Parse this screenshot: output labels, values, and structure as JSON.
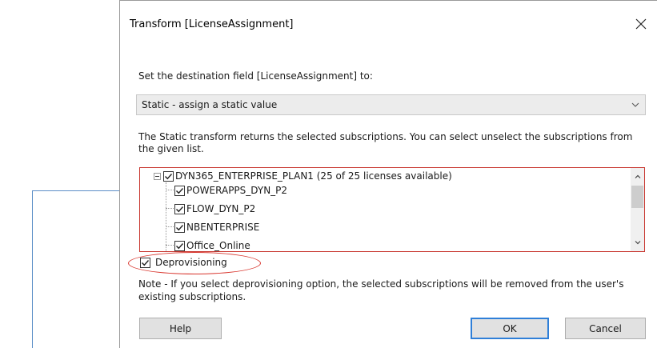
{
  "dialog": {
    "title": "Transform [LicenseAssignment]",
    "prompt": "Set the destination field [LicenseAssignment] to:",
    "dropdown_value": "Static - assign a static value",
    "description": "The Static transform returns the selected subscriptions. You can select unselect the subscriptions from the given list.",
    "tree": {
      "root": {
        "label": "DYN365_ENTERPRISE_PLAN1 (25 of 25 licenses available)",
        "checked": true,
        "expanded": true
      },
      "children": [
        {
          "label": "POWERAPPS_DYN_P2",
          "checked": true
        },
        {
          "label": "FLOW_DYN_P2",
          "checked": true
        },
        {
          "label": "NBENTERPRISE",
          "checked": true
        },
        {
          "label": "Office_Online",
          "checked": true
        }
      ]
    },
    "deprovisioning": {
      "label": "Deprovisioning",
      "checked": true
    },
    "note": "Note - If you select deprovisioning option, the selected subscriptions will be removed from the user's existing subscriptions.",
    "buttons": {
      "help": "Help",
      "ok": "OK",
      "cancel": "Cancel"
    }
  },
  "colors": {
    "highlight_red": "#d8342c",
    "accent_blue": "#2f7fd8",
    "annotation_line": "#5b8ec7"
  }
}
